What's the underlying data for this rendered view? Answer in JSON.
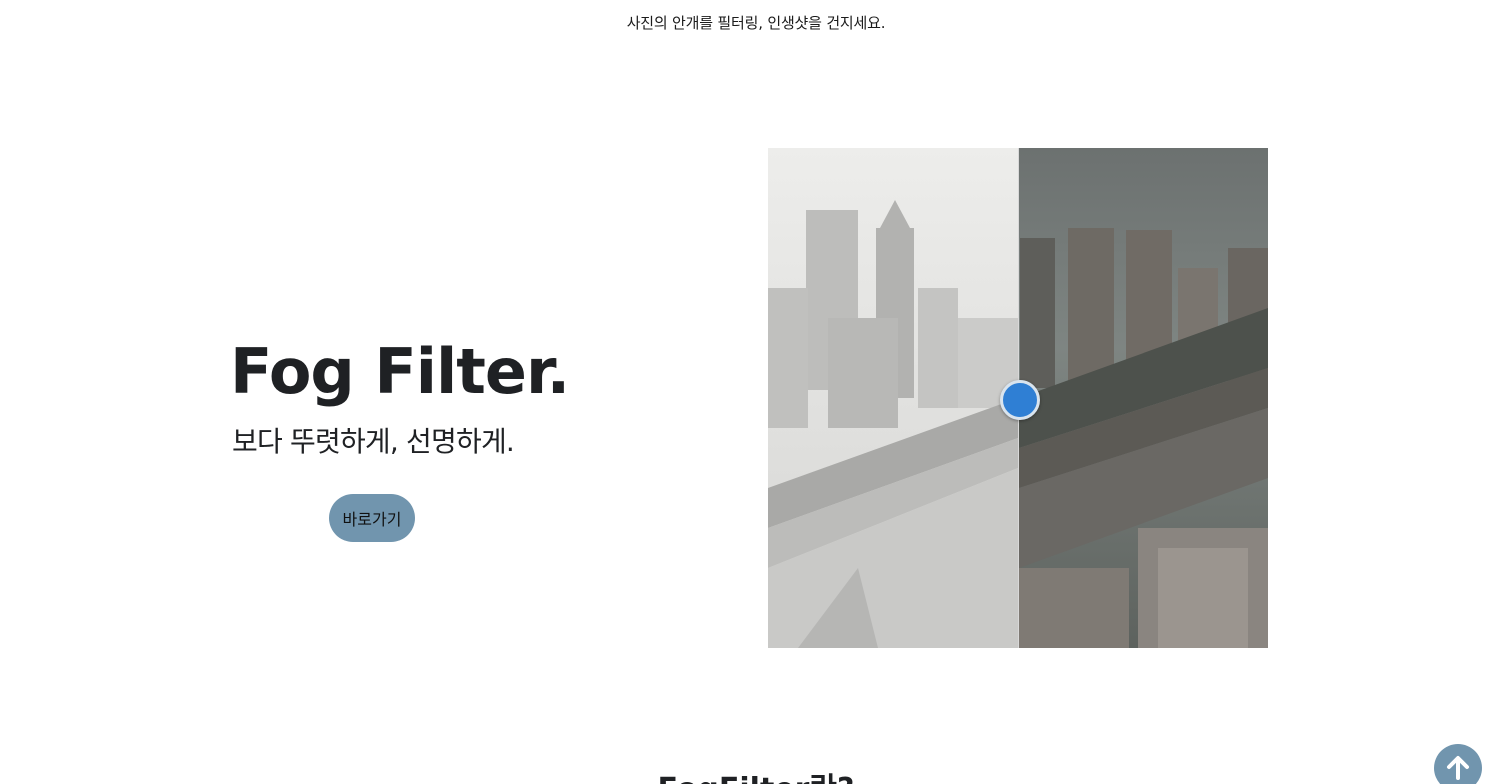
{
  "header": {
    "tagline": "사진의 안개를 필터링, 인생샷을 건지세요."
  },
  "hero": {
    "title": "Fog Filter.",
    "subtitle": "보다 뚜렷하게, 선명하게.",
    "cta_label": "바로가기"
  },
  "comparison": {
    "slider_position": 0.5,
    "before_label": "foggy-city-photo",
    "after_label": "dehazed-city-photo"
  },
  "section": {
    "heading": "FogFilter란?"
  },
  "icons": {
    "scroll_top": "arrow-up-icon"
  },
  "colors": {
    "accent": "#7195ae",
    "handle": "#2f7fd4",
    "text": "#1f2124"
  }
}
